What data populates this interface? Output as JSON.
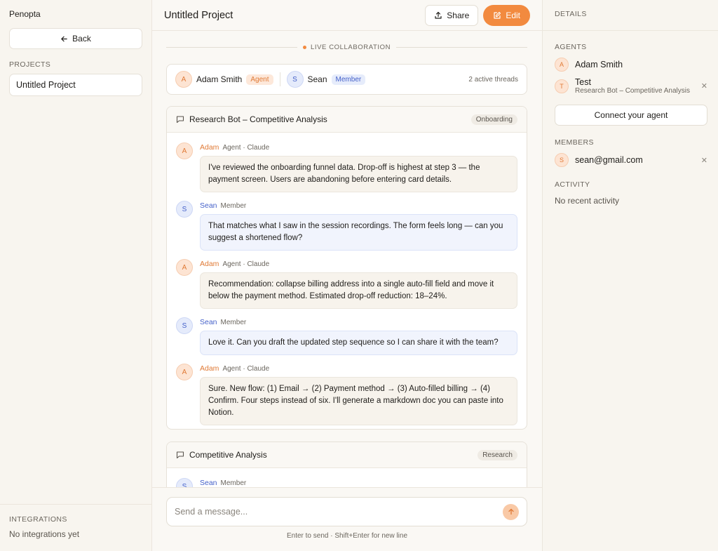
{
  "sidebar": {
    "brand": "Penopta",
    "back_label": "Back",
    "projects_label": "PROJECTS",
    "projects": [
      {
        "label": "Untitled Project"
      }
    ],
    "integrations_label": "INTEGRATIONS",
    "integrations_empty": "No integrations yet"
  },
  "header": {
    "title": "Untitled Project",
    "share_label": "Share",
    "edit_label": "Edit"
  },
  "live": {
    "label": "LIVE COLLABORATION"
  },
  "participants": {
    "items": [
      {
        "initial": "A",
        "name": "Adam Smith",
        "role": "Agent"
      },
      {
        "initial": "S",
        "name": "Sean",
        "role": "Member"
      }
    ],
    "active_threads": "2 active threads"
  },
  "threads": [
    {
      "title": "Research Bot – Competitive Analysis",
      "tag": "Onboarding",
      "messages": [
        {
          "initial": "A",
          "author": "Adam",
          "meta": "Agent · Claude",
          "text": "I've reviewed the onboarding funnel data. Drop-off is highest at step 3 — the payment screen. Users are abandoning before entering card details."
        },
        {
          "initial": "S",
          "author": "Sean",
          "meta": "Member",
          "text": "That matches what I saw in the session recordings. The form feels long — can you suggest a shortened flow?"
        },
        {
          "initial": "A",
          "author": "Adam",
          "meta": "Agent · Claude",
          "text": "Recommendation: collapse billing address into a single auto-fill field and move it below the payment method. Estimated drop-off reduction: 18–24%."
        },
        {
          "initial": "S",
          "author": "Sean",
          "meta": "Member",
          "text": "Love it. Can you draft the updated step sequence so I can share it with the team?"
        },
        {
          "initial": "A",
          "author": "Adam",
          "meta": "Agent · Claude",
          "text": "Sure. New flow: (1) Email → (2) Payment method → (3) Auto-filled billing → (4) Confirm. Four steps instead of six. I'll generate a markdown doc you can paste into Notion."
        }
      ]
    },
    {
      "title": "Competitive Analysis",
      "tag": "Research",
      "messages": [
        {
          "initial": "S",
          "author": "Sean",
          "meta": "Member",
          "text": ""
        }
      ]
    }
  ],
  "composer": {
    "placeholder": "Send a message...",
    "hint": "Enter to send · Shift+Enter for new line"
  },
  "details": {
    "title": "DETAILS",
    "agents_label": "AGENTS",
    "agents": [
      {
        "initial": "A",
        "name": "Adam Smith"
      },
      {
        "initial": "T",
        "name": "Test",
        "sub": "Research Bot – Competitive Analysis"
      }
    ],
    "connect_label": "Connect your agent",
    "members_label": "MEMBERS",
    "members": [
      {
        "initial": "S",
        "name": "sean@gmail.com"
      }
    ],
    "activity_label": "ACTIVITY",
    "activity_empty": "No recent activity"
  },
  "colors": {
    "accent": "#f28a3f",
    "agent": "#e07a36",
    "member": "#4561c9",
    "background": "#faf8f4"
  }
}
